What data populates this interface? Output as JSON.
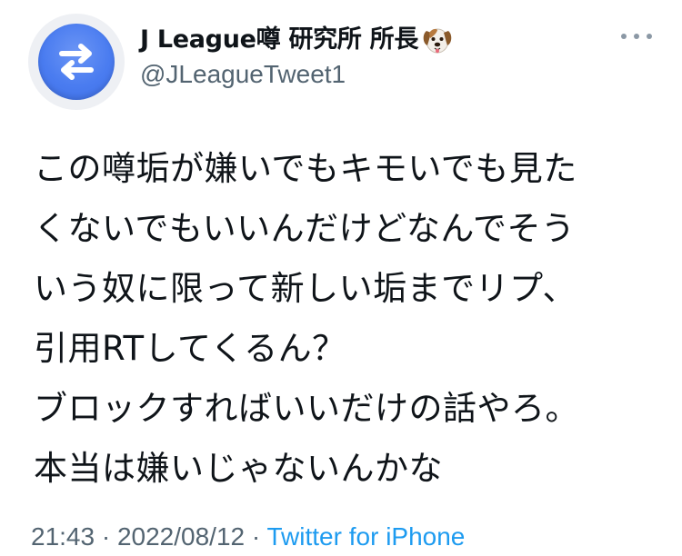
{
  "author": {
    "display_name": "J League噂 研究所 所長",
    "name_emoji": "dog-face-icon",
    "handle": "@JLeagueTweet1",
    "avatar_icon": "swap-arrows-icon"
  },
  "tweet": {
    "lines": [
      "この噂垢が嫌いでもキモいでも見た",
      "くないでもいいんだけどなんでそう",
      "いう奴に限って新しい垢までリプ、",
      "引用RTしてくるん？",
      "ブロックすればいいだけの話やろ。",
      "本当は嫌いじゃないんかな"
    ]
  },
  "meta": {
    "time": "21:43",
    "separator1": " · ",
    "date": "2022/08/12",
    "separator2": " · ",
    "source": "Twitter for iPhone"
  },
  "colors": {
    "text": "#0f1419",
    "secondary": "#536471",
    "link": "#1d9bf0",
    "avatar": "#4a7cf0"
  }
}
